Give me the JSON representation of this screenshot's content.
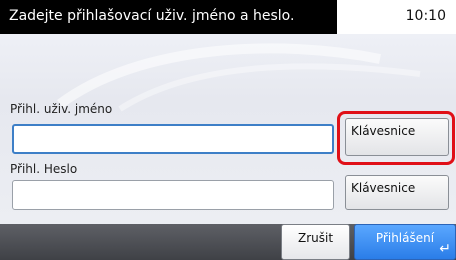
{
  "header": {
    "title": "Zadejte přihlašovací uživ. jméno a heslo.",
    "clock": "10:10"
  },
  "form": {
    "username_label": "Přihl. uživ. jméno",
    "username_value": "",
    "password_label": "Přihl. Heslo",
    "password_value": "",
    "keyboard_button_label": "Klávesnice"
  },
  "footer": {
    "cancel_label": "Zrušit",
    "login_label": "Přihlášení"
  },
  "icons": {
    "enter": "enter-icon"
  },
  "colors": {
    "highlight_red": "#e01018",
    "login_blue": "#2a7de8",
    "focus_blue": "#3d7fc7"
  }
}
